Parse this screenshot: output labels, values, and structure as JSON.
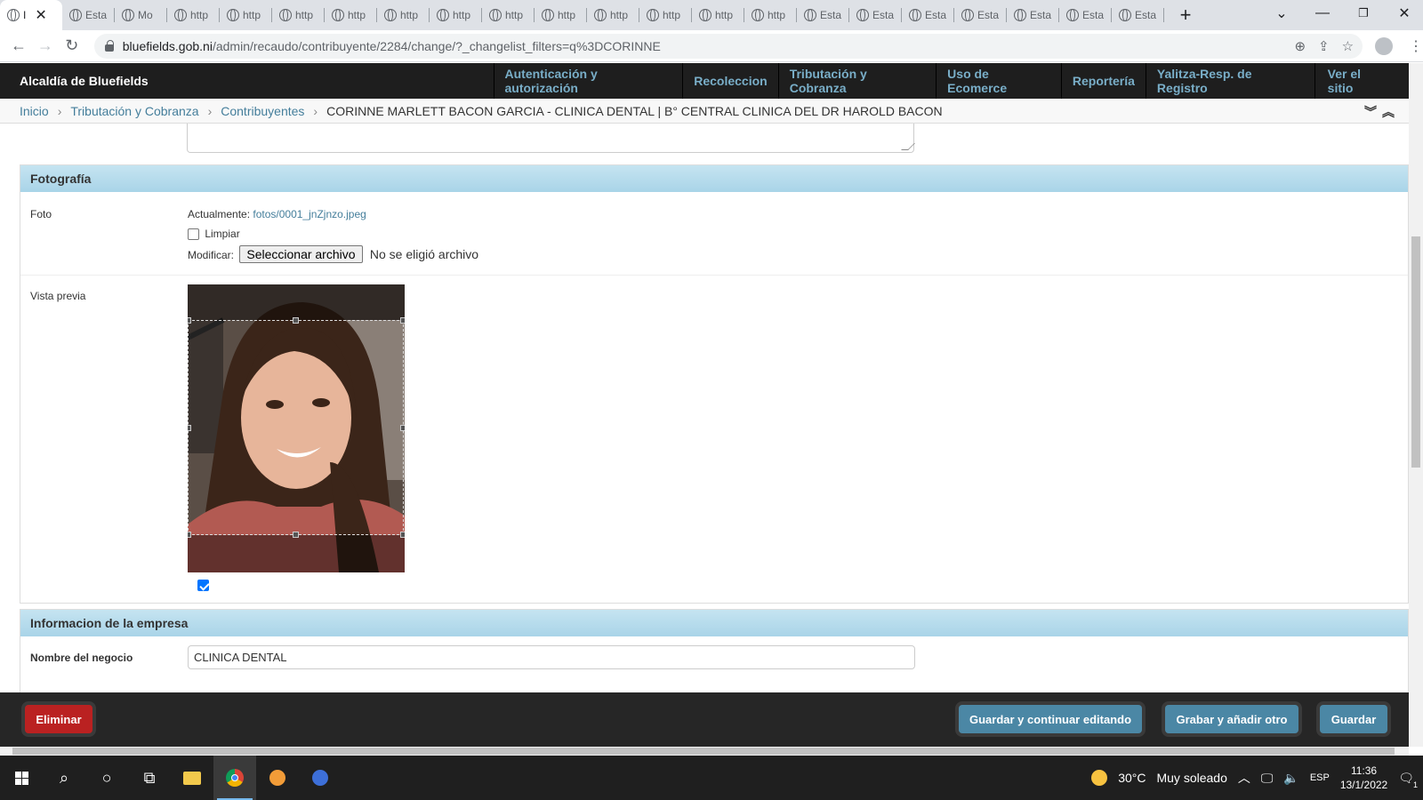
{
  "browser": {
    "tabs": [
      {
        "title": "I",
        "active": true
      },
      {
        "title": "Esta"
      },
      {
        "title": "Mo"
      },
      {
        "title": "http"
      },
      {
        "title": "http"
      },
      {
        "title": "http"
      },
      {
        "title": "http"
      },
      {
        "title": "http"
      },
      {
        "title": "http"
      },
      {
        "title": "http"
      },
      {
        "title": "http"
      },
      {
        "title": "http"
      },
      {
        "title": "http"
      },
      {
        "title": "http"
      },
      {
        "title": "http"
      },
      {
        "title": "Esta"
      },
      {
        "title": "Esta"
      },
      {
        "title": "Esta"
      },
      {
        "title": "Esta"
      },
      {
        "title": "Esta"
      },
      {
        "title": "Esta"
      },
      {
        "title": "Esta"
      }
    ],
    "url_host": "bluefields.gob.ni",
    "url_path": "/admin/recaudo/contribuyente/2284/change/?_changelist_filters=q%3DCORINNE"
  },
  "header": {
    "brand": "Alcaldía de Bluefields",
    "menu": [
      "Autenticación y autorización",
      "Recoleccion",
      "Tributación y Cobranza",
      "Uso de Ecomerce",
      "Reportería",
      "Yalitza-Resp. de Registro"
    ],
    "site_link": "Ver el sitio"
  },
  "breadcrumbs": {
    "home": "Inicio",
    "app": "Tributación y Cobranza",
    "model": "Contribuyentes",
    "current": "CORINNE MARLETT BACON GARCIA - CLINICA DENTAL | B° CENTRAL CLINICA DEL DR HAROLD BACON"
  },
  "fotografia": {
    "title": "Fotografía",
    "foto_label": "Foto",
    "currently_label": "Actualmente:",
    "current_file": "fotos/0001_jnZjnzo.jpeg",
    "clear_label": "Limpiar",
    "change_label": "Modificar:",
    "file_button": "Seleccionar archivo",
    "no_file": "No se eligió archivo",
    "preview_label": "Vista previa",
    "crop_enabled": true
  },
  "empresa": {
    "title": "Informacion de la empresa",
    "business_label": "Nombre del negocio",
    "business_value": "CLINICA DENTAL"
  },
  "actions": {
    "delete": "Eliminar",
    "save_continue": "Guardar y continuar editando",
    "save_add": "Grabar y añadir otro",
    "save": "Guardar"
  },
  "taskbar": {
    "temperature": "30°C",
    "weather": "Muy soleado",
    "lang": "ESP",
    "time": "11:36",
    "date": "13/1/2022",
    "notifications": "1"
  },
  "colors": {
    "admin_header": "#1e1e1e",
    "admin_link": "#79aec8",
    "fieldset_title": "#b9dcec",
    "delete": "#ba2121",
    "save": "#4b87a5"
  }
}
